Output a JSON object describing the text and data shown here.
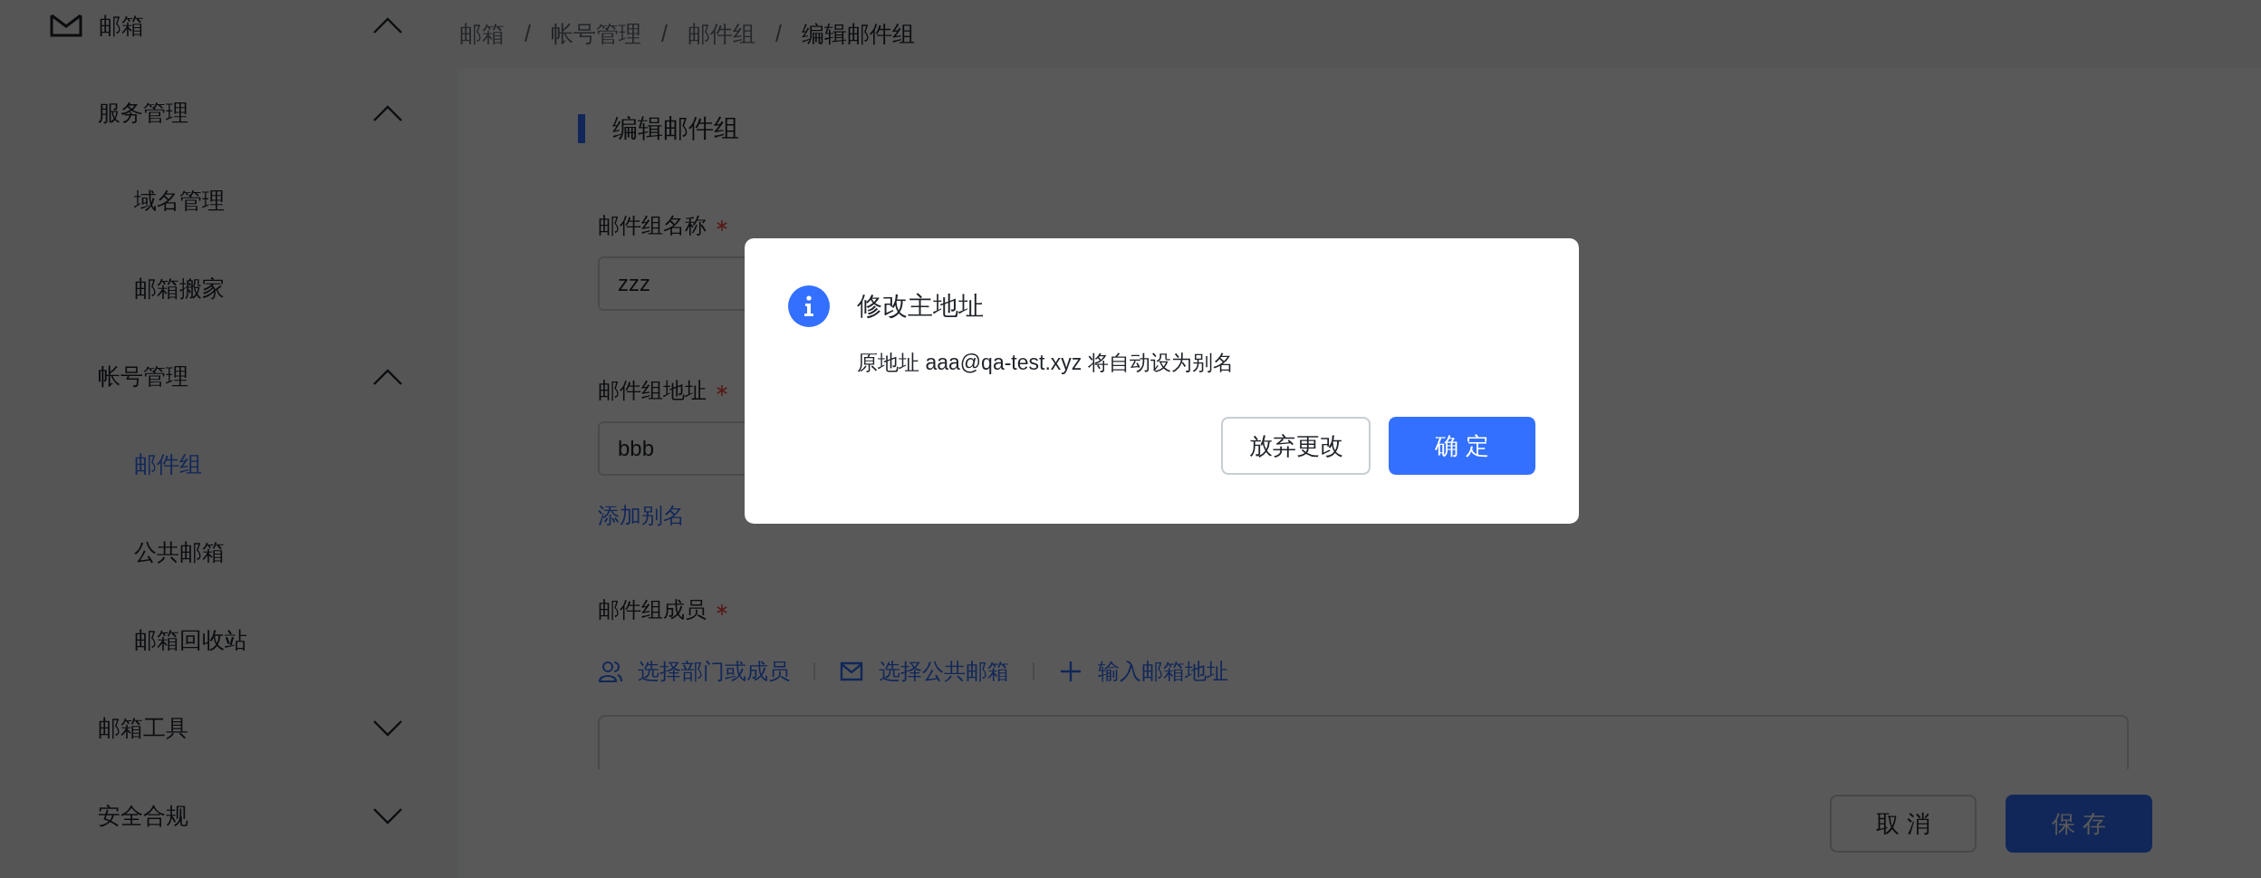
{
  "sidebar": {
    "items": [
      {
        "label": "邮箱",
        "kind": "mail",
        "expanded": true,
        "children": [
          {
            "label": "服务管理",
            "expanded": true,
            "children": [
              {
                "label": "域名管理",
                "selected": false
              },
              {
                "label": "邮箱搬家",
                "selected": false
              }
            ]
          },
          {
            "label": "帐号管理",
            "expanded": true,
            "children": [
              {
                "label": "邮件组",
                "selected": true
              },
              {
                "label": "公共邮箱",
                "selected": false
              },
              {
                "label": "邮箱回收站",
                "selected": false
              }
            ]
          },
          {
            "label": "邮箱工具",
            "expanded": false
          },
          {
            "label": "安全合规",
            "expanded": false
          }
        ]
      }
    ]
  },
  "breadcrumb": {
    "separator": "/",
    "items": [
      {
        "label": "邮箱",
        "current": false
      },
      {
        "label": "帐号管理",
        "current": false
      },
      {
        "label": "邮件组",
        "current": false
      },
      {
        "label": "编辑邮件组",
        "current": true
      }
    ]
  },
  "form": {
    "title": "编辑邮件组",
    "fields": [
      {
        "label": "邮件组名称",
        "required": true,
        "value": "zzz"
      },
      {
        "label": "邮件组地址",
        "required": true,
        "value": "bbb"
      }
    ],
    "alias_link": "添加别名",
    "members": {
      "label": "邮件组成员",
      "required": true,
      "actions": [
        {
          "label": "选择部门或成员",
          "kind": "people"
        },
        {
          "label": "选择公共邮箱",
          "kind": "mail"
        },
        {
          "label": "输入邮箱地址",
          "kind": "plus"
        }
      ]
    },
    "buttons": [
      {
        "label": "取 消",
        "kind": "secondary"
      },
      {
        "label": "保 存",
        "kind": "primary"
      }
    ]
  },
  "dialog": {
    "kind": "info",
    "title": "修改主地址",
    "message": "原地址 aaa@qa-test.xyz 将自动设为别名",
    "buttons": [
      {
        "label": "放弃更改",
        "kind": "secondary"
      },
      {
        "label": "确 定",
        "kind": "primary"
      }
    ]
  }
}
